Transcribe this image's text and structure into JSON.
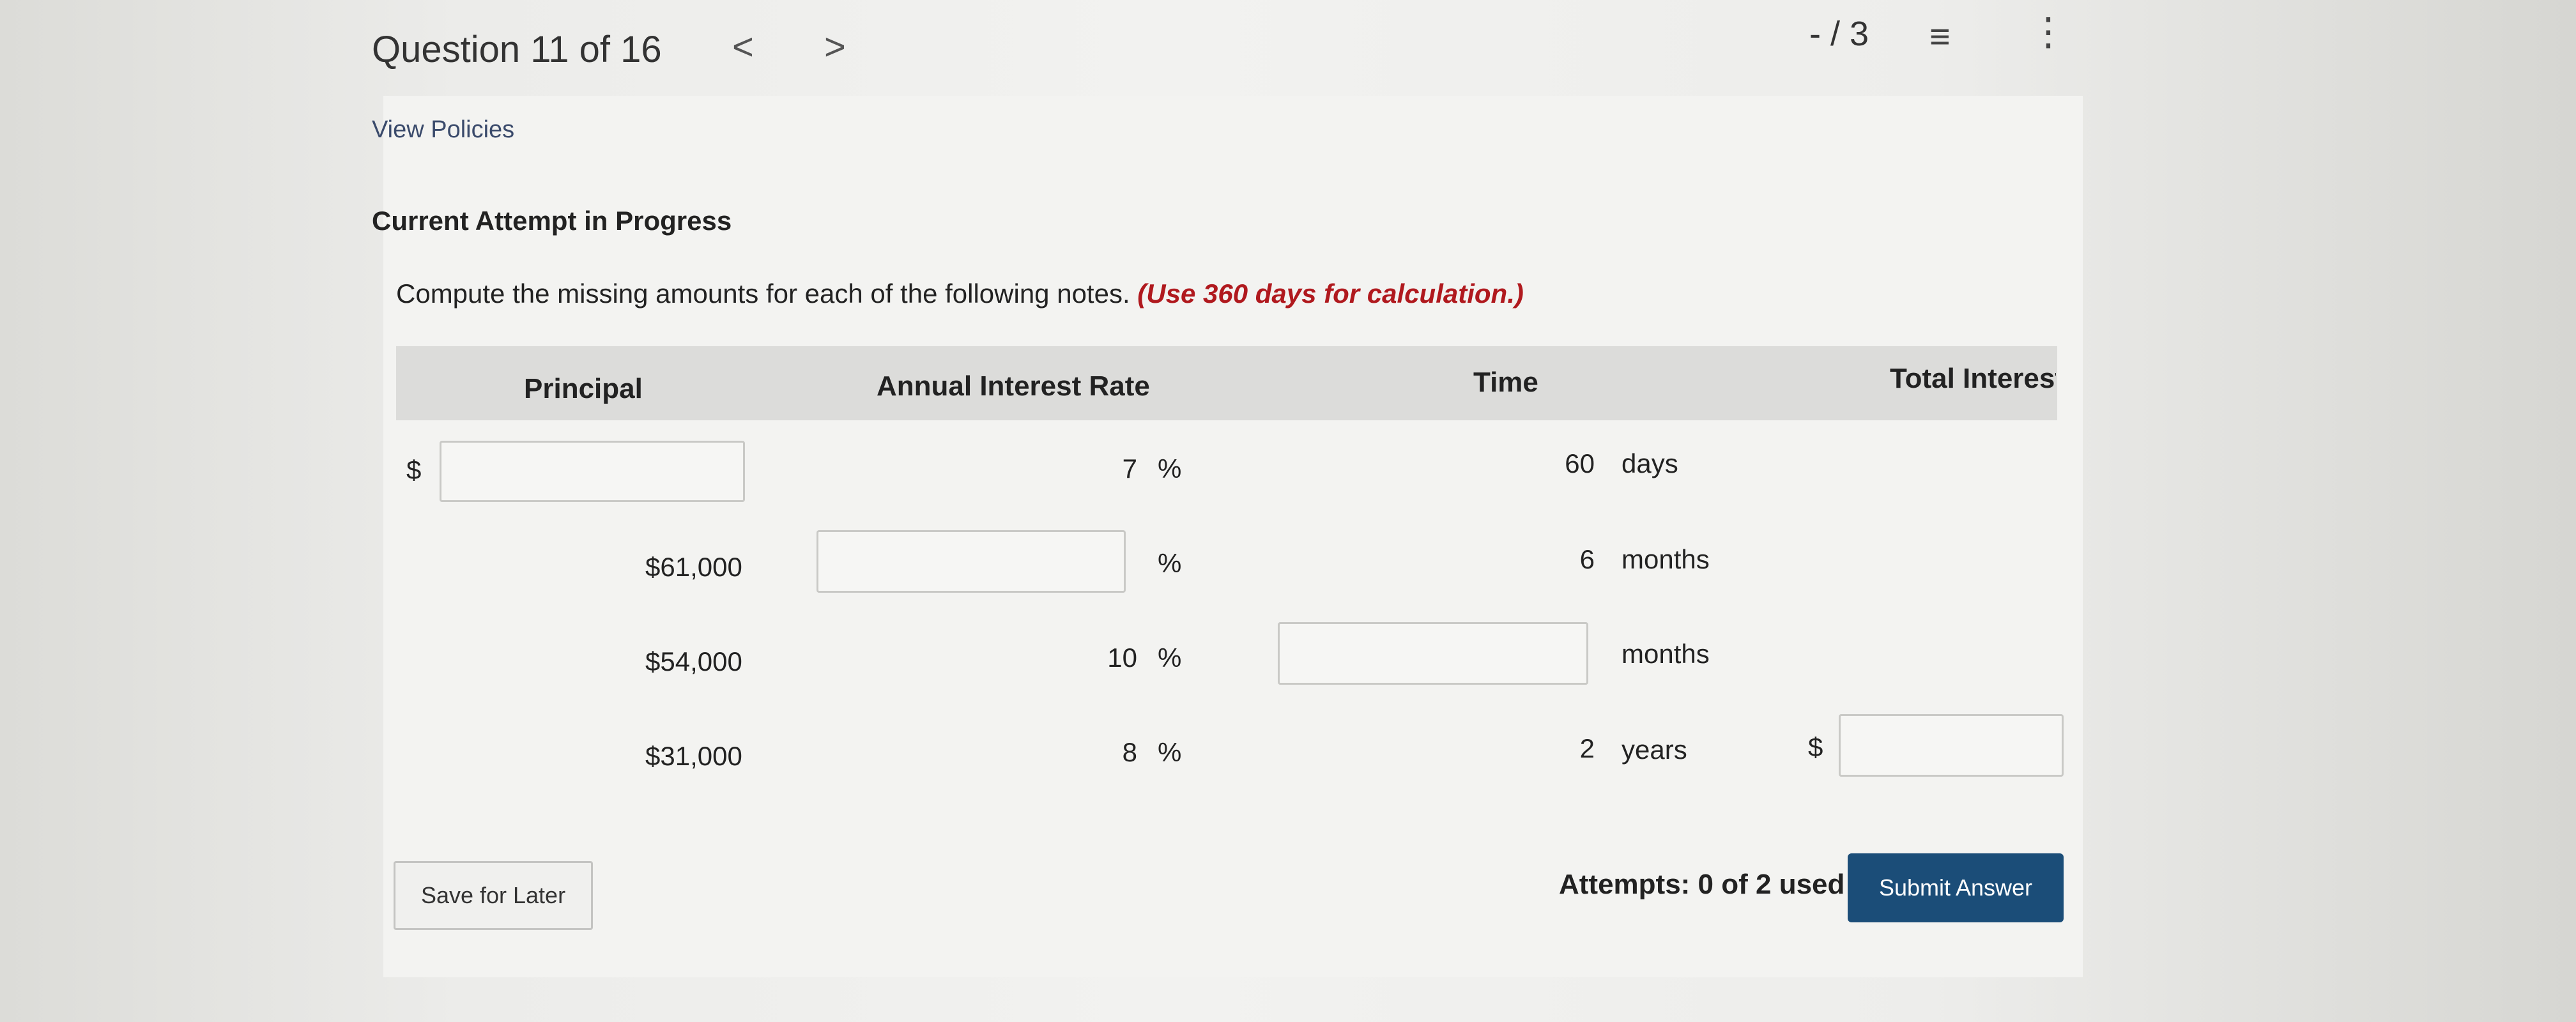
{
  "header": {
    "question_counter": "Question 11 of 16",
    "prev_arrow": "<",
    "next_arrow": ">",
    "score": "- / 3",
    "list_icon": "list-icon",
    "more_icon": "more-vertical-icon"
  },
  "links": {
    "view_policies": "View Policies"
  },
  "attempt_title": "Current Attempt in Progress",
  "instructions": {
    "text": "Compute the missing amounts for each of the following notes.",
    "note": "(Use 360 days for calculation.)"
  },
  "table": {
    "headers": [
      "Principal",
      "Annual Interest Rate",
      "Time",
      "Total Interest"
    ],
    "rows": [
      {
        "principal_prefix": "$",
        "principal": "",
        "rate": "7",
        "rate_unit": "%",
        "time": "60",
        "time_unit": "days",
        "interest_prefix": "",
        "interest": ""
      },
      {
        "principal_prefix": "",
        "principal": "$61,000",
        "rate": "",
        "rate_unit": "%",
        "time": "6",
        "time_unit": "months",
        "interest_prefix": "",
        "interest": ""
      },
      {
        "principal_prefix": "",
        "principal": "$54,000",
        "rate": "10",
        "rate_unit": "%",
        "time": "",
        "time_unit": "months",
        "interest_prefix": "",
        "interest": ""
      },
      {
        "principal_prefix": "",
        "principal": "$31,000",
        "rate": "8",
        "rate_unit": "%",
        "time": "2",
        "time_unit": "years",
        "interest_prefix": "$",
        "interest": ""
      }
    ]
  },
  "footer": {
    "save_label": "Save for Later",
    "attempts": "Attempts: 0 of 2 used",
    "submit_label": "Submit Answer"
  },
  "colors": {
    "accent": "#1b4d78",
    "note_red": "#b0191e"
  }
}
